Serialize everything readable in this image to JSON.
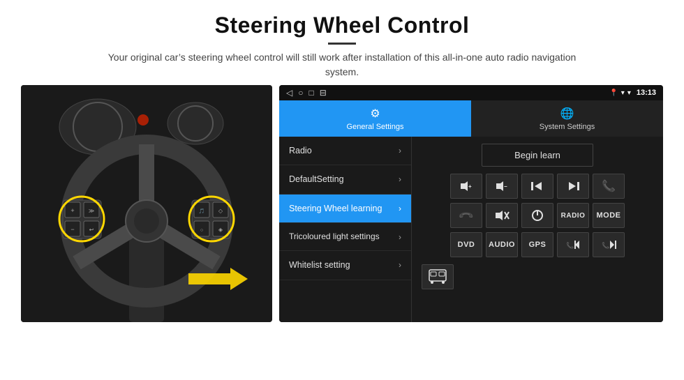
{
  "page": {
    "title": "Steering Wheel Control",
    "subtitle": "Your original car’s steering wheel control will still work after installation of this all-in-one auto radio navigation system."
  },
  "status_bar": {
    "time": "13:13",
    "nav_icons": [
      "◁",
      "○",
      "□",
      "⊟"
    ]
  },
  "tabs": [
    {
      "id": "general",
      "label": "General Settings",
      "active": true
    },
    {
      "id": "system",
      "label": "System Settings",
      "active": false
    }
  ],
  "menu_items": [
    {
      "id": "radio",
      "label": "Radio",
      "active": false
    },
    {
      "id": "default",
      "label": "DefaultSetting",
      "active": false
    },
    {
      "id": "steering",
      "label": "Steering Wheel learning",
      "active": true
    },
    {
      "id": "tricoloured",
      "label": "Tricoloured light settings",
      "active": false
    },
    {
      "id": "whitelist",
      "label": "Whitelist setting",
      "active": false
    }
  ],
  "controls": {
    "begin_learn": "Begin learn",
    "row1": [
      "🔊+",
      "🔊−",
      "⏮",
      "⏭",
      "☎"
    ],
    "row2": [
      "☎",
      "🔇",
      "⏻",
      "RADIO",
      "MODE"
    ],
    "row3": [
      "DVD",
      "AUDIO",
      "GPS",
      "📞⏮",
      "📞⏭"
    ]
  },
  "icons": {
    "settings_gear": "⚙",
    "system_icon": "🌐",
    "chevron": "›",
    "whitelist_icon": "🚌"
  }
}
